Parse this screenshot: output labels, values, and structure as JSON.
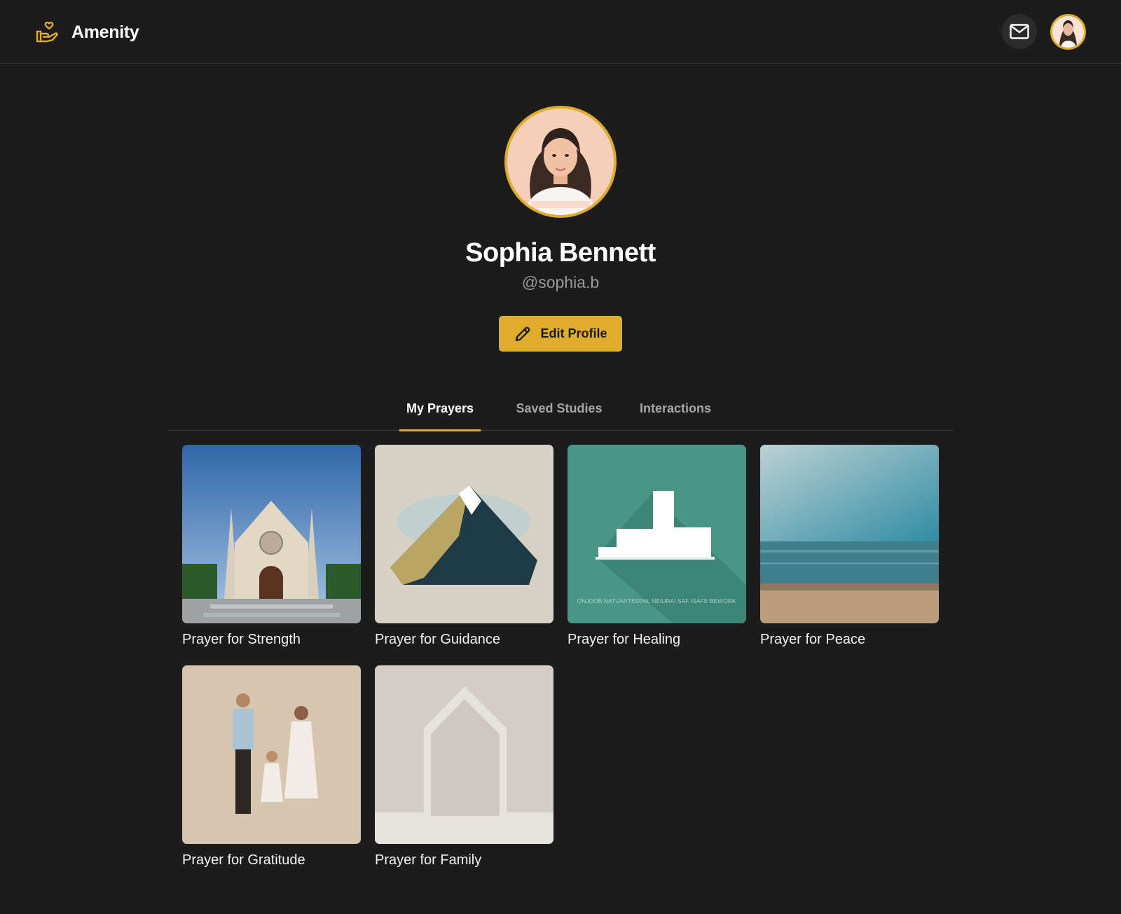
{
  "app": {
    "name": "Amenity",
    "brand_color": "#e0ac2c",
    "logo_icon": "hand-heart-icon"
  },
  "header": {
    "mail_icon": "mail-icon",
    "avatar_alt": "user-avatar"
  },
  "profile": {
    "name": "Sophia Bennett",
    "handle": "@sophia.b",
    "edit_label": "Edit Profile"
  },
  "tabs": [
    {
      "label": "My Prayers",
      "active": true
    },
    {
      "label": "Saved Studies",
      "active": false
    },
    {
      "label": "Interactions",
      "active": false
    }
  ],
  "prayers": [
    {
      "title": "Prayer for Strength",
      "image": "church"
    },
    {
      "title": "Prayer for Guidance",
      "image": "mountain"
    },
    {
      "title": "Prayer for Healing",
      "image": "building",
      "image_caption": "ONJOOB NATUARTEIRAIL NEIURAI SAF ISAFE BEWORK"
    },
    {
      "title": "Prayer for Peace",
      "image": "sea"
    },
    {
      "title": "Prayer for Gratitude",
      "image": "family"
    },
    {
      "title": "Prayer for Family",
      "image": "house"
    }
  ]
}
